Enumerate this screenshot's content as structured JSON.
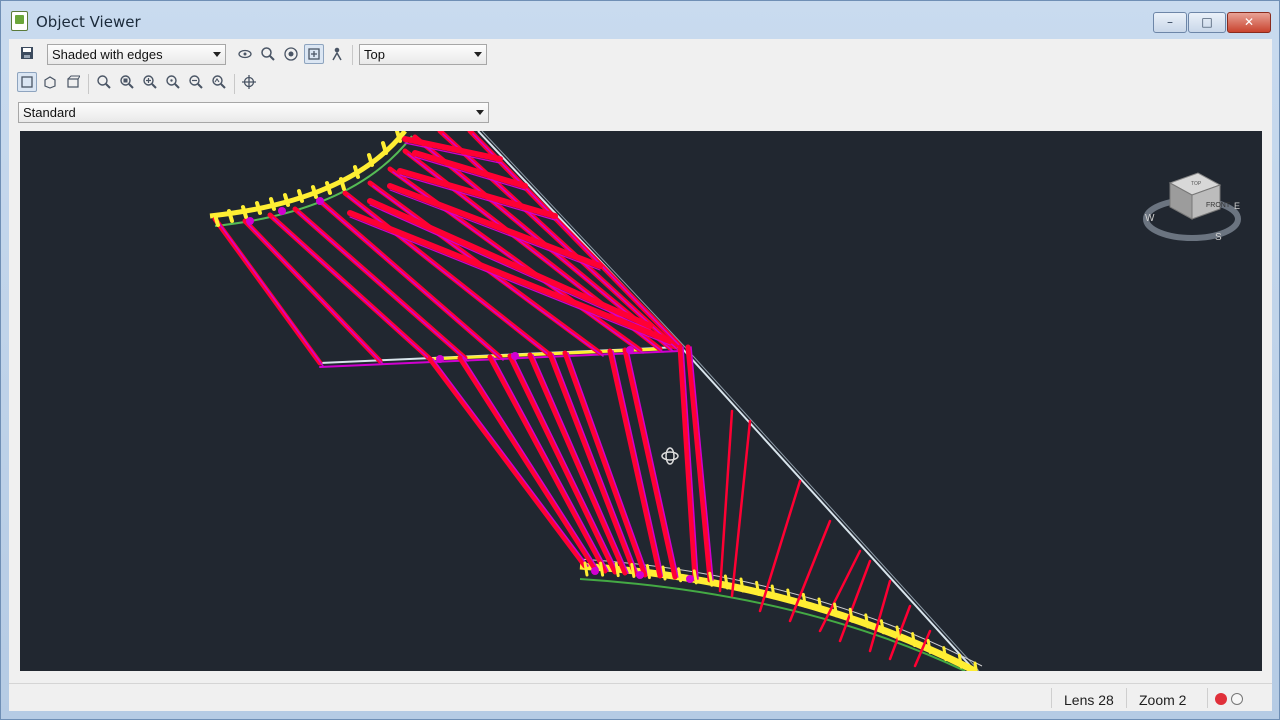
{
  "window": {
    "title": "Object Viewer",
    "min_glyph": "–",
    "max_glyph": "□",
    "close_glyph": "✕"
  },
  "toolbar": {
    "visual_style": "Shaded with edges",
    "view": "Top",
    "visual_preset": "Standard"
  },
  "status": {
    "lens": "Lens 28",
    "zoom": "Zoom 2"
  },
  "viewcube": {
    "face": "FRONT",
    "top_face": "TOP",
    "west": "W",
    "south": "S",
    "east": "E"
  },
  "colors": {
    "viewport_bg": "#212730",
    "rebar_red": "#ff0033",
    "rebar_magenta": "#d000d0",
    "highlight": "#ffee33",
    "edge_white": "#d8e4ec"
  }
}
